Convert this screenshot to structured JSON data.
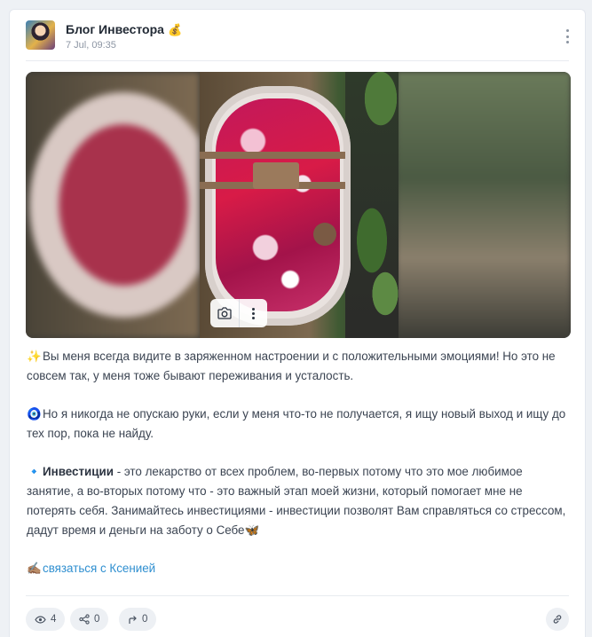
{
  "post": {
    "channel_name": "Блог Инвестора",
    "channel_badge": "💰",
    "timestamp": "7 Jul, 09:35"
  },
  "media": {
    "type": "photo",
    "controls": [
      "camera-icon",
      "more-vertical-icon"
    ]
  },
  "body": {
    "p1_emoji": "✨",
    "p1_text": "Вы меня всегда видите в заряженном настроении и с положительными эмоциями! Но это не совсем так, у меня тоже бывают переживания и усталость.",
    "p2_emoji": "🧿",
    "p2_text": "Но я никогда не опускаю руки, если у меня что-то не получается, я ищу новый выход и ищу до тех пор, пока не найду.",
    "p3_emoji": "🔹",
    "p3_bold": "Инвестиции",
    "p3_text": " - это лекарство от всех проблем, во-первых потому что это мое любимое занятие, а во-вторых потому что - это важный этап моей жизни, который помогает мне не потерять себя. Занимайтесь инвестициями - инвестиции позволят Вам справляться со стрессом, дадут время и деньги на заботу о Себе",
    "p3_end_emoji": "🦋",
    "link_emoji": "✍🏽",
    "link_text": "связаться с Ксенией"
  },
  "footer": {
    "views": "4",
    "shares": "0",
    "forwards": "0",
    "icons": [
      "eye-icon",
      "share-icon",
      "forward-icon",
      "link-icon"
    ]
  },
  "colors": {
    "link": "#2f8fd0",
    "pill_bg": "#edf0f4",
    "card_bg": "#ffffff",
    "page_bg": "#eef1f5"
  }
}
